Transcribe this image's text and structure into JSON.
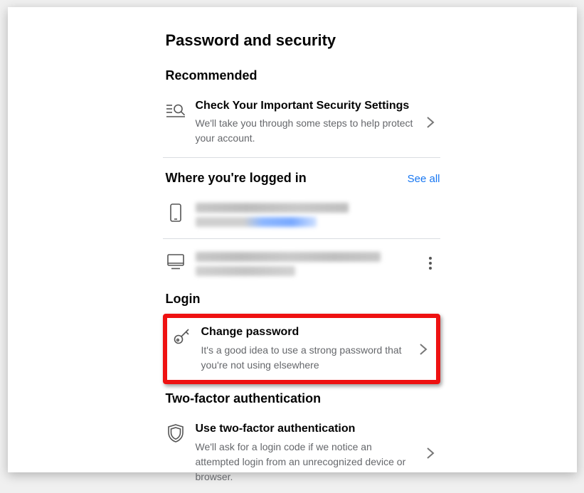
{
  "page_title": "Password and security",
  "sections": {
    "recommended": {
      "heading": "Recommended",
      "item": {
        "title": "Check Your Important Security Settings",
        "subtitle": "We'll take you through some steps to help protect your account."
      }
    },
    "logged_in": {
      "heading": "Where you're logged in",
      "see_all": "See all"
    },
    "login": {
      "heading": "Login",
      "item": {
        "title": "Change password",
        "subtitle": "It's a good idea to use a strong password that you're not using elsewhere"
      }
    },
    "two_factor": {
      "heading": "Two-factor authentication",
      "item": {
        "title": "Use two-factor authentication",
        "subtitle": "We'll ask for a login code if we notice an attempted login from an unrecognized device or browser."
      }
    }
  }
}
